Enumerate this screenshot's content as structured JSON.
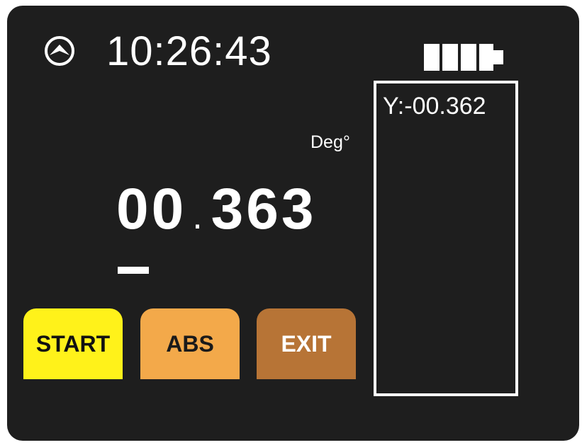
{
  "status": {
    "icon": "compass-arrow-icon",
    "time": "10:26:43",
    "battery_icon": "battery-full-icon",
    "battery_level": 1.0
  },
  "measurement": {
    "unit": "Deg°",
    "integer_part": "00",
    "decimal_point": ".",
    "fraction_part": "363",
    "sign": "—"
  },
  "buttons": {
    "start_label": "START",
    "abs_label": "ABS",
    "exit_label": "EXIT"
  },
  "side_panel": {
    "value": "Y:-00.362"
  },
  "colors": {
    "background": "#1e1e1e",
    "text": "#ffffff",
    "start": "#fff21a",
    "abs": "#f3a94a",
    "exit": "#b77436"
  }
}
